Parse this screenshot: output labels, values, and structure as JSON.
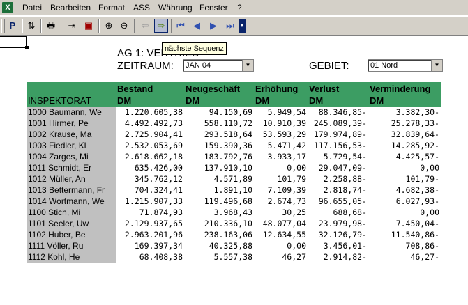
{
  "app": {
    "icon": "excel-icon"
  },
  "menu": [
    "Datei",
    "Bearbeiten",
    "Format",
    "ASS",
    "Währung",
    "Fenster",
    "?"
  ],
  "toolbar": {
    "buttons": [
      {
        "name": "p-button",
        "glyph": "P"
      },
      {
        "name": "sort-button",
        "glyph": "⇅"
      },
      {
        "name": "print-button",
        "glyph": "🖶"
      },
      {
        "name": "export-button",
        "glyph": "⇥"
      },
      {
        "name": "save-button",
        "glyph": "▣"
      },
      {
        "name": "zoom-in-button",
        "glyph": "⊕"
      },
      {
        "name": "zoom-out-button",
        "glyph": "⊖"
      },
      {
        "name": "previous-sequence-button",
        "glyph": "⇦"
      },
      {
        "name": "next-sequence-button",
        "glyph": "⇨"
      },
      {
        "name": "first-button",
        "glyph": "⏮"
      },
      {
        "name": "previous-button",
        "glyph": "◀"
      },
      {
        "name": "next-button",
        "glyph": "▶"
      },
      {
        "name": "last-button",
        "glyph": "⏭"
      }
    ],
    "tooltip": "nächste Sequenz"
  },
  "report": {
    "title": "AG 1: VERTRIEB",
    "zeitraum_label": "ZEITRAUM:",
    "zeitraum_value": "JAN 04",
    "gebiet_label": "GEBIET:",
    "gebiet_value": "01 Nord"
  },
  "table": {
    "headers": [
      {
        "line1": "",
        "line2": "INSPEKTORAT"
      },
      {
        "line1": "Bestand",
        "line2": "DM"
      },
      {
        "line1": "Neugeschäft",
        "line2": "DM"
      },
      {
        "line1": "Erhöhung",
        "line2": "DM"
      },
      {
        "line1": "Verlust",
        "line2": "DM"
      },
      {
        "line1": "Verminderung",
        "line2": "DM"
      }
    ],
    "rows": [
      [
        "1000 Baumann, We",
        "1.220.605,38",
        "94.150,69",
        "5.949,54",
        "88.346,85-",
        "3.382,30-"
      ],
      [
        "1001 Hirmer, Pe",
        "4.492.492,73",
        "558.110,72",
        "10.910,39",
        "245.089,39-",
        "25.278,33-"
      ],
      [
        "1002 Krause, Ma",
        "2.725.904,41",
        "293.518,64",
        "53.593,29",
        "179.974,89-",
        "32.839,64-"
      ],
      [
        "1003 Fiedler, Kl",
        "2.532.053,69",
        "159.390,36",
        "5.471,42",
        "117.156,53-",
        "14.285,92-"
      ],
      [
        "1004 Zarges, Mi",
        "2.618.662,18",
        "183.792,76",
        "3.933,17",
        "5.729,54-",
        "4.425,57-"
      ],
      [
        "1011 Schmidt, Er",
        "635.426,00",
        "137.910,10",
        "0,00",
        "29.047,09-",
        "0,00"
      ],
      [
        "1012 Müller, An",
        "345.762,12",
        "4.571,89",
        "101,79",
        "2.258,88-",
        "101,79-"
      ],
      [
        "1013 Bettermann, Fr",
        "704.324,41",
        "1.891,10",
        "7.109,39",
        "2.818,74-",
        "4.682,38-"
      ],
      [
        "1014 Wortmann, We",
        "1.215.907,33",
        "119.496,68",
        "2.674,73",
        "96.655,05-",
        "6.027,93-"
      ],
      [
        "1100 Stich, Mi",
        "71.874,93",
        "3.968,43",
        "30,25",
        "688,68-",
        "0,00"
      ],
      [
        "1101 Seeler, Uw",
        "2.129.937,65",
        "210.336,10",
        "48.077,04",
        "23.979,98-",
        "7.450,04-"
      ],
      [
        "1102 Huber, Be",
        "2.963.201,96",
        "238.163,06",
        "12.634,55",
        "32.126,79-",
        "11.540,86-"
      ],
      [
        "1111 Völler, Ru",
        "169.397,34",
        "40.325,88",
        "0,00",
        "3.456,01-",
        "708,86-"
      ],
      [
        "1112 Kohl, He",
        "68.408,38",
        "5.557,38",
        "46,27",
        "2.914,82-",
        "46,27-"
      ]
    ]
  }
}
